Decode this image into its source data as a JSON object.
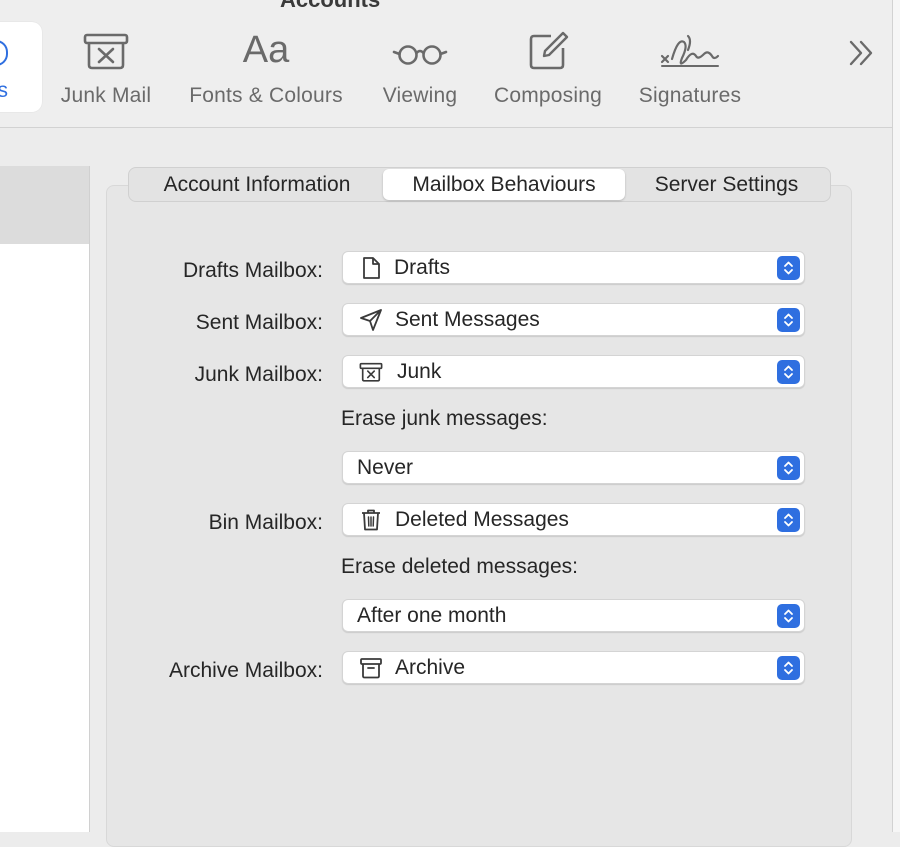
{
  "window": {
    "title": "Accounts"
  },
  "toolbar": {
    "active": {
      "label": "nts",
      "full_name": "Accounts"
    },
    "items": [
      {
        "label": "Junk Mail",
        "icon": "junk-mail-icon"
      },
      {
        "label": "Fonts & Colours",
        "icon": "fonts-icon",
        "glyph": "Aa"
      },
      {
        "label": "Viewing",
        "icon": "glasses-icon"
      },
      {
        "label": "Composing",
        "icon": "compose-icon"
      },
      {
        "label": "Signatures",
        "icon": "signature-icon"
      }
    ],
    "more_icon": "chevron-double-right-icon"
  },
  "tabs": [
    {
      "label": "Account Information",
      "selected": false
    },
    {
      "label": "Mailbox Behaviours",
      "selected": true
    },
    {
      "label": "Server Settings",
      "selected": false
    }
  ],
  "mailbox": {
    "drafts": {
      "label": "Drafts Mailbox:",
      "value": "Drafts",
      "icon": "document-icon"
    },
    "sent": {
      "label": "Sent Mailbox:",
      "value": "Sent Messages",
      "icon": "paper-plane-icon"
    },
    "junk": {
      "label": "Junk Mailbox:",
      "value": "Junk",
      "icon": "junk-box-icon"
    },
    "erase_junk": {
      "label": "Erase junk messages:",
      "value": "Never"
    },
    "bin": {
      "label": "Bin Mailbox:",
      "value": "Deleted Messages",
      "icon": "trash-icon"
    },
    "erase_deleted": {
      "label": "Erase deleted messages:",
      "value": "After one month"
    },
    "archive": {
      "label": "Archive Mailbox:",
      "value": "Archive",
      "icon": "archive-box-icon"
    }
  },
  "colors": {
    "accent": "#2f6fe0",
    "panel": "#e6e6e6",
    "toolbar": "#eeeeee"
  }
}
